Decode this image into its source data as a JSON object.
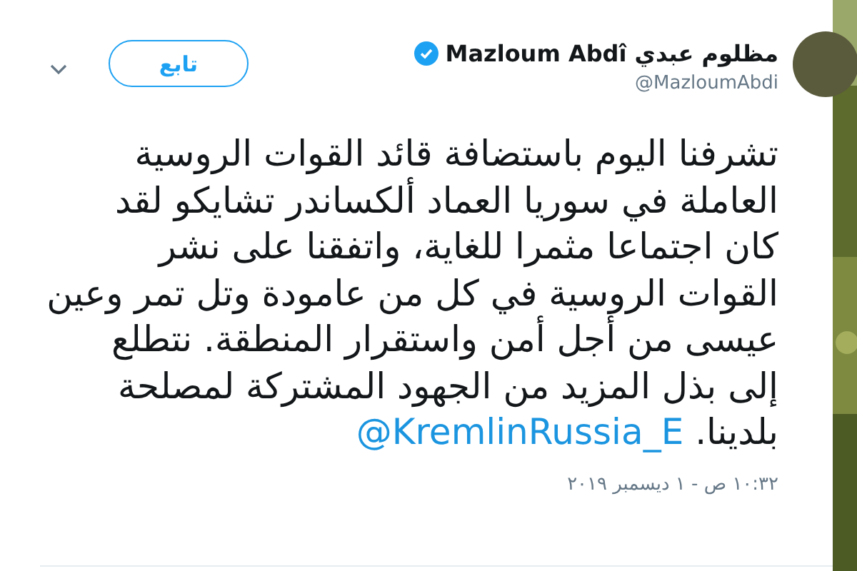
{
  "tweet": {
    "display_name": "Mazloum Abdî مظلوم عبدي",
    "verified": true,
    "handle": "@MazloumAbdi",
    "follow_button": "تابع",
    "lines": [
      "تشرفنا اليوم باستضافة قائد القوات الروسية",
      "العاملة في سوريا العماد ألكساندر تشايكو  لقد",
      "كان اجتماعا مثمرا للغاية، واتفقنا على نشر",
      "القوات الروسية في كل من عامودة وتل تمر وعين",
      "عيسى من أجل أمن واستقرار المنطقة. نتطلع",
      "إلى بذل المزيد من الجهود المشتركة لمصلحة",
      "بلدينا."
    ],
    "mention": "@KremlinRussia_E",
    "timestamp": "١٠:٣٢ ص - ١ ديسمبر ٢٠١٩"
  }
}
